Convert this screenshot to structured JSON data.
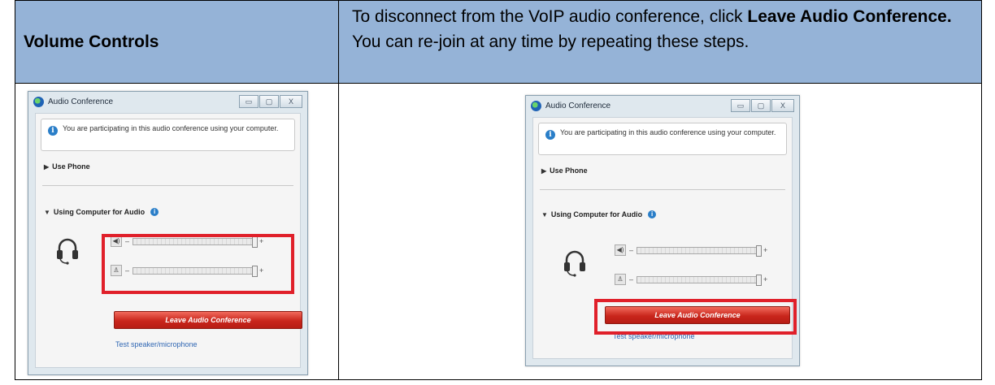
{
  "header": {
    "left_title": "Volume Controls",
    "instruction_part1": "To disconnect from the VoIP audio conference, click ",
    "instruction_bold": "Leave Audio Conference.",
    "instruction_part2": " You can re-join at any time by repeating these steps."
  },
  "window": {
    "title": "Audio Conference",
    "minimize_glyph": "▭",
    "maximize_glyph": "▢",
    "close_glyph": "X",
    "info_glyph": "i",
    "info_text": "You are participating in this audio conference using your computer.",
    "use_phone_label": "Use Phone",
    "using_computer_label": "Using Computer for Audio",
    "help_glyph": "i",
    "speaker_glyph": "◀)",
    "mic_glyph": "♙",
    "minus": "–",
    "plus": "+",
    "leave_button": "Leave Audio Conference",
    "test_link": "Test speaker/microphone"
  },
  "icons": {
    "app": "audio-conference-icon",
    "info": "info-icon",
    "headset": "headset-icon",
    "speaker": "speaker-icon",
    "microphone": "microphone-icon"
  },
  "colors": {
    "header_bg": "#95b3d7",
    "highlight": "#e0202a",
    "leave_button": "#c9261c"
  }
}
